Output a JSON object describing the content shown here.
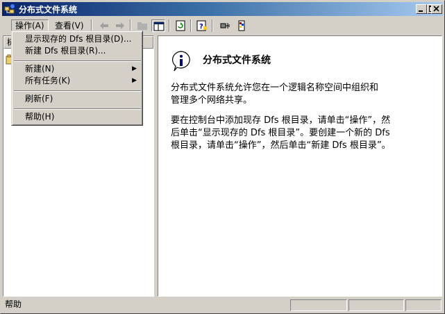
{
  "window": {
    "title": "分布式文件系统",
    "controls": {
      "minimize": "minimize-icon",
      "maximize": "maximize-icon",
      "close": "close-icon"
    }
  },
  "menubar": {
    "items": [
      {
        "label": "操作(A)",
        "active": true
      },
      {
        "label": "查看(V)",
        "active": false
      }
    ]
  },
  "toolbar": {
    "icons": [
      "back-arrow-icon",
      "forward-arrow-icon",
      "up-folder-icon",
      "show-hide-tree-icon",
      "refresh-icon",
      "help-icon",
      "connect-icon",
      "properties-icon"
    ]
  },
  "action_menu": {
    "items": [
      {
        "label": "显示现存的 Dfs 根目录(D)...",
        "submenu": false
      },
      {
        "label": "新建 Dfs 根目录(R)...",
        "submenu": false
      },
      {
        "separator": true
      },
      {
        "label": "新建(N)",
        "submenu": true
      },
      {
        "label": "所有任务(K)",
        "submenu": true
      },
      {
        "separator": true
      },
      {
        "label": "刷新(F)",
        "submenu": false
      },
      {
        "separator": true
      },
      {
        "label": "帮助(H)",
        "submenu": false
      }
    ]
  },
  "left_pane": {
    "header": "树"
  },
  "right_pane": {
    "heading": "分布式文件系统",
    "para1_lines": [
      "分布式文件系统允许您在一个逻辑名称空间中组织和",
      "管理多个网络共享。"
    ],
    "para2_lines": [
      "要在控制台中添加现存 Dfs 根目录，请单击“操作”，然",
      "后单击“显示现存的 Dfs 根目录”。要创建一个新的 Dfs",
      "根目录，请单击“操作”，然后单击“新建 Dfs 根目录”。"
    ]
  },
  "statusbar": {
    "text": "帮助"
  },
  "colors": {
    "title_start": "#0a246a",
    "title_end": "#a6caf0",
    "face": "#d4d0c8"
  }
}
